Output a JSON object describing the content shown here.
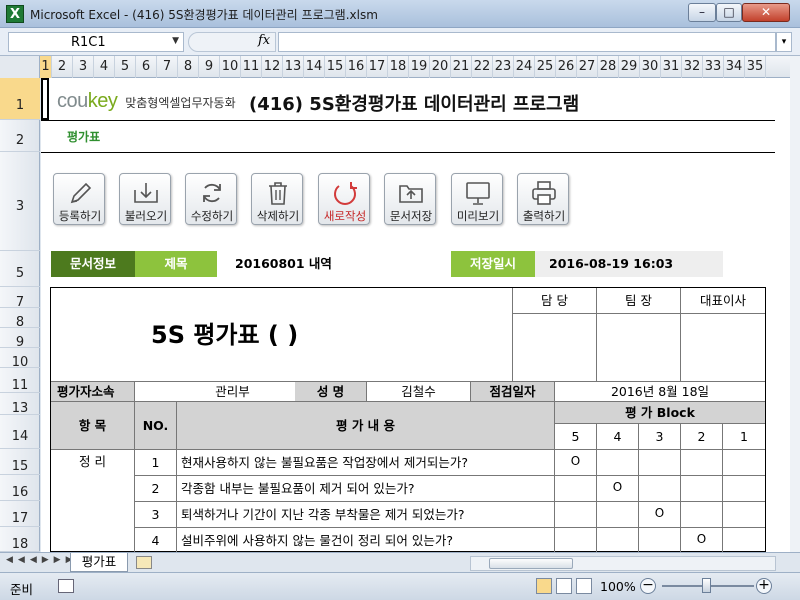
{
  "window": {
    "title": "Microsoft Excel - (416) 5S환경평가표 데이터관리 프로그램.xlsm",
    "app_icon": "X"
  },
  "formula_bar": {
    "name_box": "R1C1",
    "fx": "fx",
    "formula": ""
  },
  "columns": [
    "1",
    "2",
    "3",
    "4",
    "5",
    "6",
    "7",
    "8",
    "9",
    "10",
    "11",
    "12",
    "13",
    "14",
    "15",
    "16",
    "17",
    "18",
    "19",
    "20",
    "21",
    "22",
    "23",
    "24",
    "25",
    "26",
    "27",
    "28",
    "29",
    "30",
    "31",
    "32",
    "33",
    "34",
    "35"
  ],
  "rows": [
    "1",
    "2",
    "3",
    "5",
    "7",
    "8",
    "9",
    "10",
    "11",
    "13",
    "14",
    "15",
    "16",
    "17",
    "18"
  ],
  "header": {
    "brand_logo_a": "cou",
    "brand_logo_b": "key",
    "brand_sub": "맞춤형엑셀업무자동화",
    "app_title": "(416) 5S환경평가표 데이터관리 프로그램",
    "sheet_label": "평가표"
  },
  "toolbar": [
    {
      "label": "등록하기",
      "icon": "pencil-icon"
    },
    {
      "label": "불러오기",
      "icon": "download-tray-icon"
    },
    {
      "label": "수정하기",
      "icon": "refresh-icon"
    },
    {
      "label": "삭제하기",
      "icon": "trash-icon"
    },
    {
      "label": "새로작성",
      "icon": "new-refresh-icon"
    },
    {
      "label": "문서저장",
      "icon": "upload-tray-icon"
    },
    {
      "label": "미리보기",
      "icon": "monitor-icon"
    },
    {
      "label": "출력하기",
      "icon": "printer-icon"
    }
  ],
  "info": {
    "doc_info_label": "문서정보",
    "subject_label": "제목",
    "subject_value": "20160801 내역",
    "saved_label": "저장일시",
    "saved_value": "2016-08-19 16:03"
  },
  "form": {
    "title": "5S 평가표 (              )",
    "approvals": [
      "담 당",
      "팀 장",
      "대표이사"
    ],
    "evaluator_dept_label": "평가자소속",
    "evaluator_dept": "관리부",
    "name_label": "성 명",
    "name": "김철수",
    "date_label": "점검일자",
    "date": "2016년 8월 18일",
    "item_header": "항    목",
    "no_header": "NO.",
    "content_header": "평 가 내 용",
    "block_header": "평 가 Block",
    "scores": [
      "5",
      "4",
      "3",
      "2",
      "1"
    ],
    "category": "정    리",
    "items": [
      {
        "no": "1",
        "text": "현재사용하지 않는 불필요품은 작업장에서 제거되는가?",
        "mark": "O",
        "col": 0
      },
      {
        "no": "2",
        "text": "각종함 내부는 불필요품이 제거 되어 있는가?",
        "mark": "O",
        "col": 1
      },
      {
        "no": "3",
        "text": "퇴색하거나 기간이 지난 각종 부착물은 제거 되었는가?",
        "mark": "O",
        "col": 2
      },
      {
        "no": "4",
        "text": "설비주위에 사용하지 않는 물건이 정리 되어 있는가?",
        "mark": "O",
        "col": 3
      }
    ]
  },
  "sheet_tab": "평가표",
  "status": {
    "ready": "준비",
    "zoom": "100%"
  }
}
